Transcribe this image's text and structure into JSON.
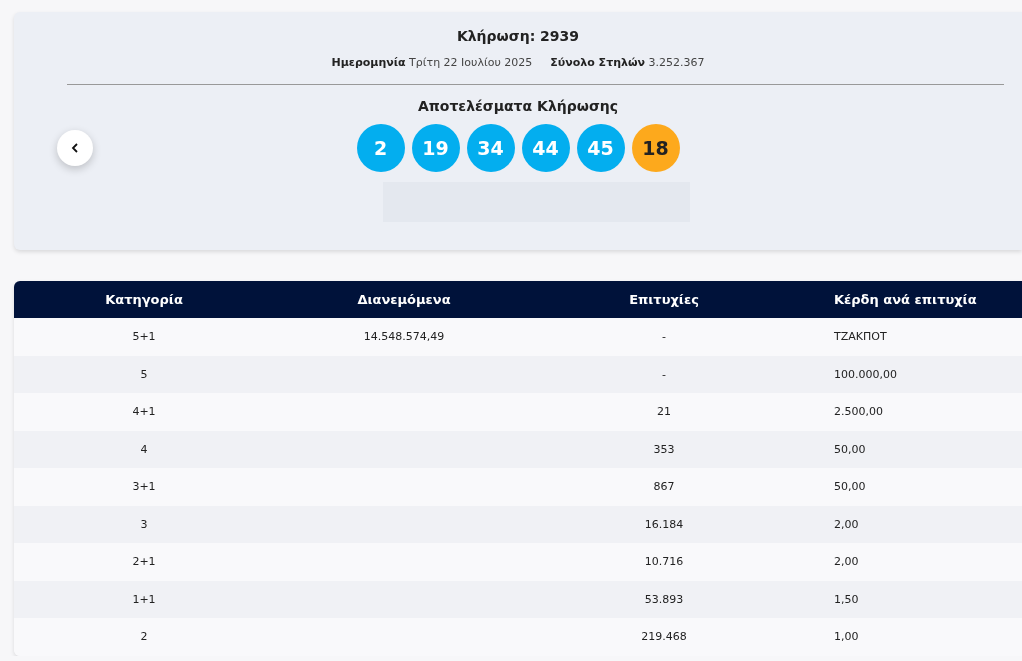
{
  "draw": {
    "title": "Κλήρωση: 2939",
    "date_label": "Ημερομηνία",
    "date": "Τρίτη 22 Ιουλίου 2025",
    "columns_label": "Σύνολο Στηλών",
    "columns": "3.252.367"
  },
  "results": {
    "title": "Αποτελέσματα Κλήρωσης",
    "balls": [
      {
        "number": "2",
        "kind": "main"
      },
      {
        "number": "19",
        "kind": "main"
      },
      {
        "number": "34",
        "kind": "main"
      },
      {
        "number": "44",
        "kind": "main"
      },
      {
        "number": "45",
        "kind": "main"
      },
      {
        "number": "18",
        "kind": "bonus"
      }
    ]
  },
  "table": {
    "columns": [
      "Κατηγορία",
      "Διανεμόμενα",
      "Επιτυχίες",
      "Κέρδη ανά επιτυχία"
    ],
    "rows": [
      [
        "5+1",
        "14.548.574,49",
        "-",
        "ΤΖΑΚΠΟΤ"
      ],
      [
        "5",
        "",
        "-",
        "100.000,00"
      ],
      [
        "4+1",
        "",
        "21",
        "2.500,00"
      ],
      [
        "4",
        "",
        "353",
        "50,00"
      ],
      [
        "3+1",
        "",
        "867",
        "50,00"
      ],
      [
        "3",
        "",
        "16.184",
        "2,00"
      ],
      [
        "2+1",
        "",
        "10.716",
        "2,00"
      ],
      [
        "1+1",
        "",
        "53.893",
        "1,50"
      ],
      [
        "2",
        "",
        "219.468",
        "1,00"
      ]
    ]
  }
}
